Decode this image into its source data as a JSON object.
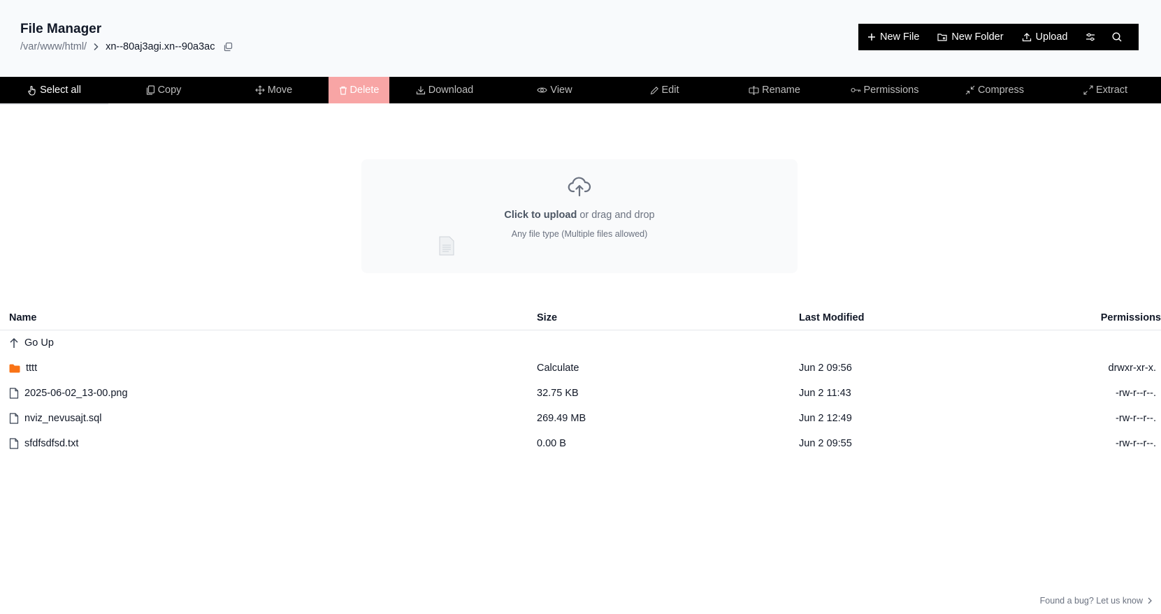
{
  "header": {
    "title": "File Manager",
    "breadcrumb": {
      "root": "/var/www/html/",
      "current": "xn--80aj3agi.xn--90a3ac"
    },
    "actions": {
      "new_file": "New File",
      "new_folder": "New Folder",
      "upload": "Upload"
    }
  },
  "toolbar": {
    "select_all": "Select all",
    "copy": "Copy",
    "move": "Move",
    "delete": "Delete",
    "download": "Download",
    "view": "View",
    "edit": "Edit",
    "rename": "Rename",
    "permissions": "Permissions",
    "compress": "Compress",
    "extract": "Extract"
  },
  "upload_zone": {
    "cta": "Click to upload",
    "rest": " or drag and drop",
    "hint": "Any file type (Multiple files allowed)"
  },
  "table": {
    "headers": {
      "name": "Name",
      "size": "Size",
      "modified": "Last Modified",
      "permissions": "Permissions"
    },
    "go_up": "Go Up",
    "rows": [
      {
        "name": "tttt",
        "type": "folder",
        "size": "Calculate",
        "modified": "Jun 2 09:56",
        "permissions": "drwxr-xr-x."
      },
      {
        "name": "2025-06-02_13-00.png",
        "type": "file",
        "size": "32.75 KB",
        "modified": "Jun 2 11:43",
        "permissions": "-rw-r--r--."
      },
      {
        "name": "nviz_nevusajt.sql",
        "type": "file",
        "size": "269.49 MB",
        "modified": "Jun 2 12:49",
        "permissions": "-rw-r--r--."
      },
      {
        "name": "sfdfsdfsd.txt",
        "type": "file",
        "size": "0.00 B",
        "modified": "Jun 2 09:55",
        "permissions": "-rw-r--r--."
      }
    ]
  },
  "footer": {
    "bug_link": "Found a bug? Let us know"
  },
  "colors": {
    "accent_folder": "#f97316",
    "delete_bg": "#f8a5a5",
    "toolbar_bg": "#000000"
  }
}
